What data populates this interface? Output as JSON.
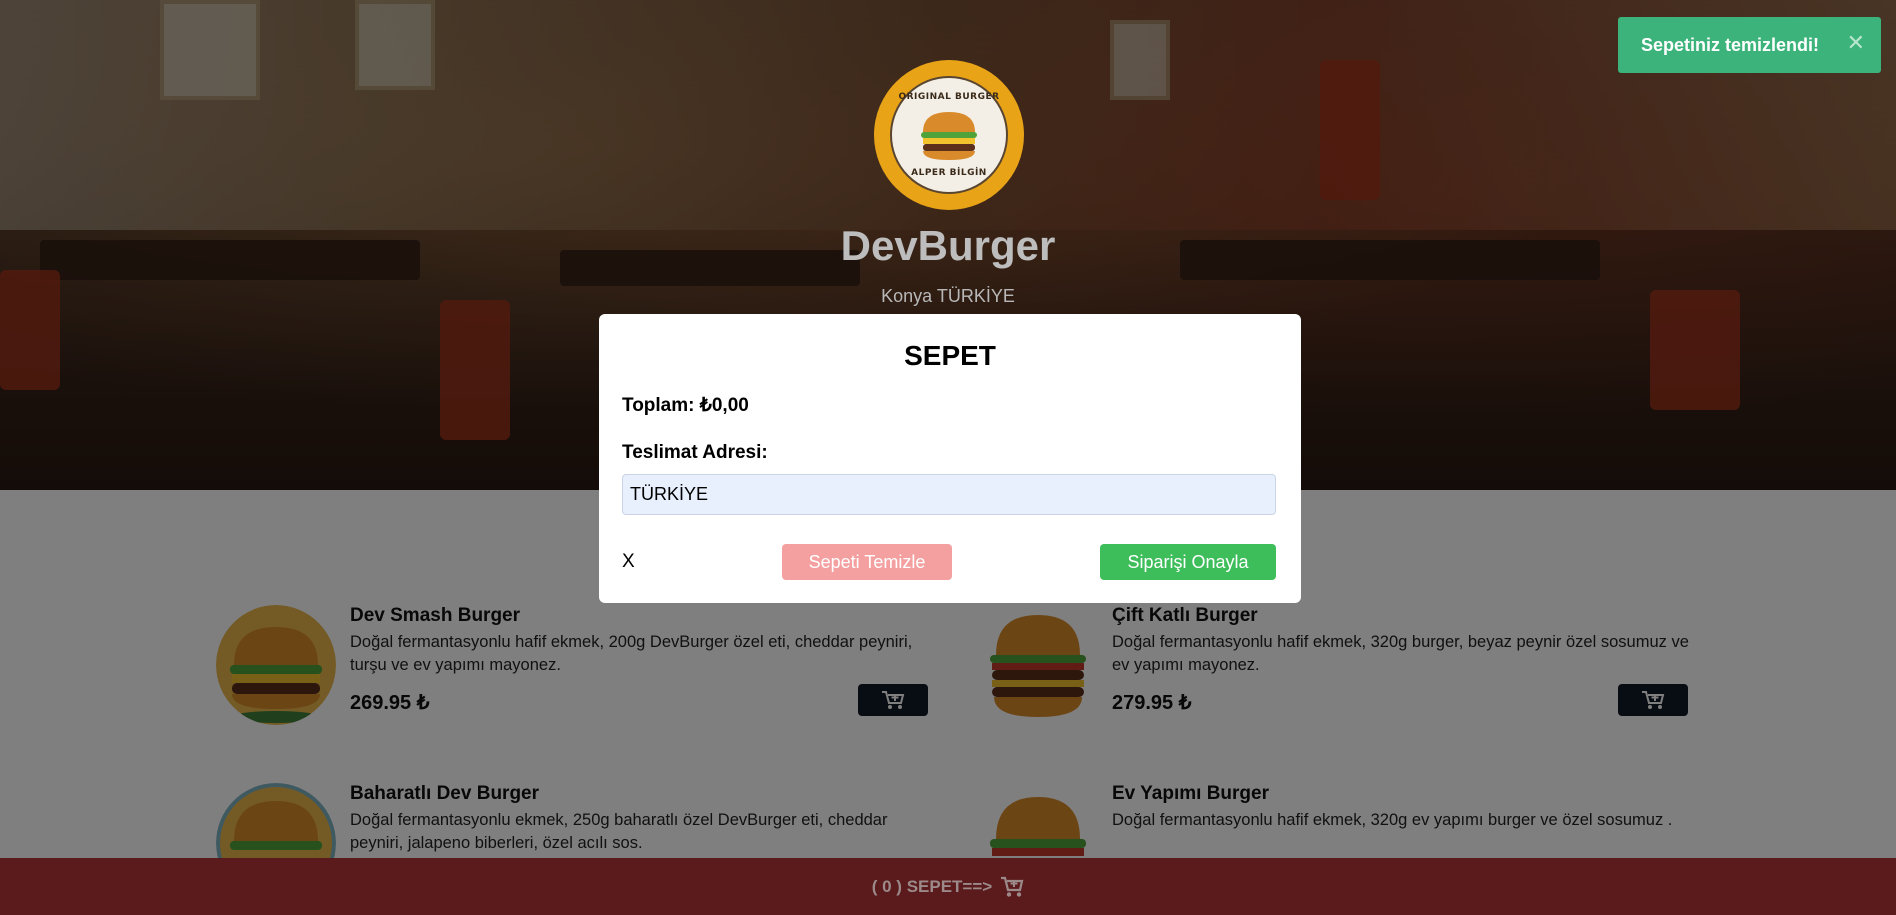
{
  "brand": {
    "title": "DevBurger",
    "subtitle": "Konya TÜRKİYE",
    "logo_text_top": "ORIGINAL BURGER",
    "logo_text_bottom": "ALPER BİLGİN"
  },
  "toast": {
    "message": "Sepetiniz temizlendi!",
    "close_label": "✕"
  },
  "modal": {
    "title": "SEPET",
    "total_label": "Toplam: ₺0,00",
    "address_label": "Teslimat Adresi:",
    "address_value": "TÜRKİYE",
    "close_label": "X",
    "clear_label": "Sepeti Temizle",
    "confirm_label": "Siparişi Onayla"
  },
  "menu": {
    "items": [
      {
        "name": "Dev Smash Burger",
        "description": "Doğal fermantasyonlu hafif ekmek, 200g DevBurger özel eti, cheddar peyniri, turşu ve ev yapımı mayonez.",
        "price": "269.95 ₺"
      },
      {
        "name": "Çift Katlı Burger",
        "description": "Doğal fermantasyonlu hafif ekmek, 320g burger, beyaz peynir özel sosumuz ve ev yapımı mayonez.",
        "price": "279.95 ₺"
      },
      {
        "name": "Baharatlı Dev Burger",
        "description": "Doğal fermantasyonlu ekmek, 250g baharatlı özel DevBurger eti, cheddar peyniri, jalapeno biberleri, özel acılı sos.",
        "price": ""
      },
      {
        "name": "Ev Yapımı Burger",
        "description": "Doğal fermantasyonlu hafif ekmek, 320g ev yapımı burger ve özel sosumuz .",
        "price": ""
      }
    ]
  },
  "cart_bar": {
    "label": "( 0 ) SEPET==>"
  },
  "colors": {
    "toast_bg": "#3cb37a",
    "clear_button": "#f4a0a0",
    "confirm_button": "#3ebd5b",
    "cart_bar": "#5b1a1c",
    "logo_ring": "#e8a317",
    "add_button": "#111827"
  },
  "icons": {
    "cart_add": "cart-plus-icon",
    "cart": "cart-icon",
    "close": "close-icon"
  }
}
